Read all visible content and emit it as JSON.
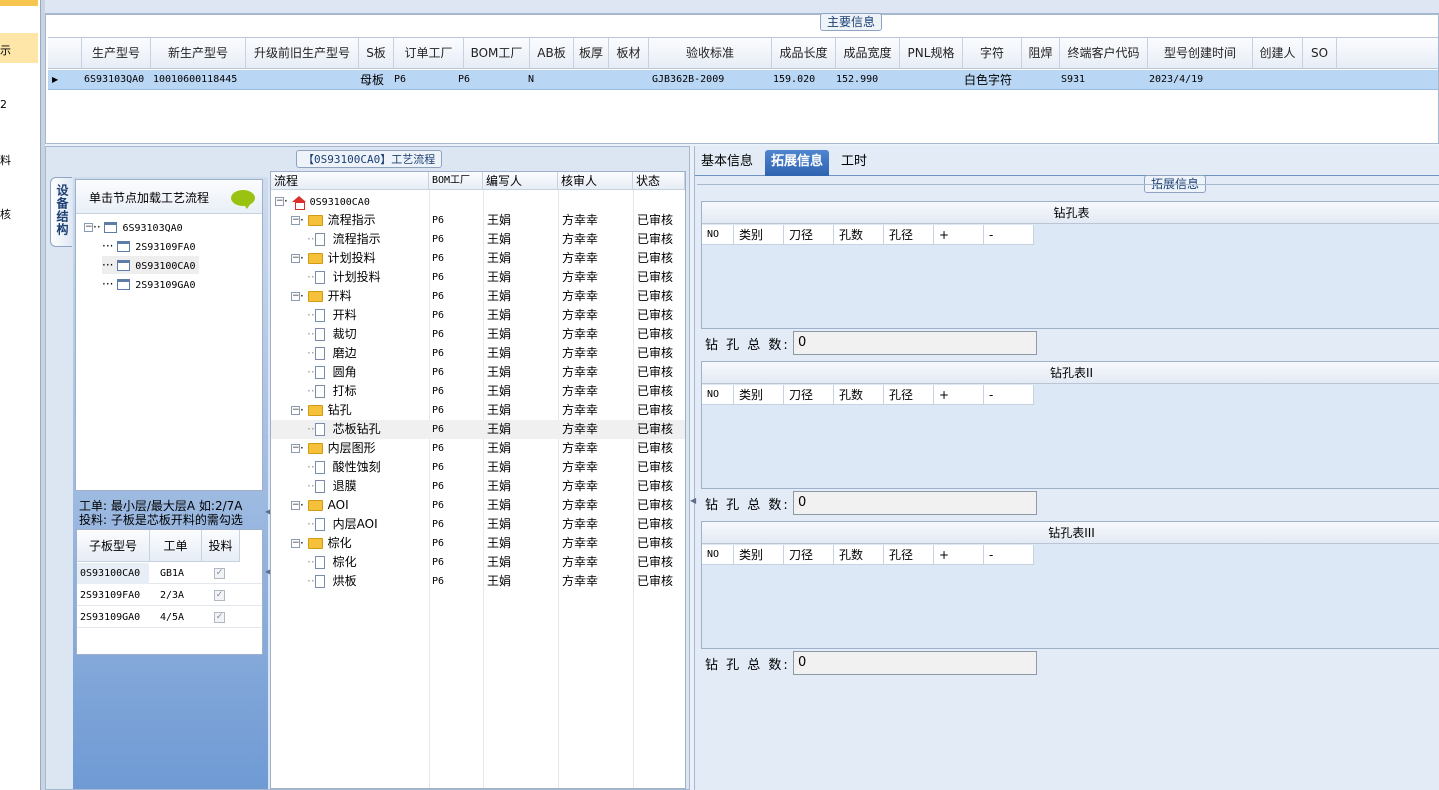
{
  "leftnav": {
    "items": [
      "示",
      "2",
      "料",
      "核"
    ]
  },
  "main": {
    "legend": "主要信息",
    "columns": [
      "生产型号",
      "新生产型号",
      "升级前旧生产型号",
      "S板",
      "订单工厂",
      "BOM工厂",
      "AB板",
      "板厚",
      "板材",
      "验收标准",
      "成品长度",
      "成品宽度",
      "PNL规格",
      "字符",
      "阻焊",
      "终端客户代码",
      "型号创建时间",
      "创建人",
      "SO"
    ],
    "row": {
      "c0": "6S93103QA0",
      "c1": "10010600118445",
      "c3": "母板",
      "c4": "P6",
      "c5": "P6",
      "c6": "N",
      "c9": "GJB362B-2009",
      "c10": "159.020",
      "c11": "152.990",
      "c13": "白色字符",
      "c15": "S931",
      "c16": "2023/4/19"
    }
  },
  "left": {
    "vtab": "设备结构",
    "tree_hint": "单击节点加载工艺流程",
    "tree": [
      "6S93103QA0",
      "2S93109FA0",
      "0S93100CA0",
      "2S93109GA0"
    ],
    "info_line1": "工单: 最小层/最大层A 如:2/7A",
    "info_line2": "投料: 子板是芯板开料的需勾选",
    "subgrid": {
      "headers": [
        "子板型号",
        "工单",
        "投料"
      ],
      "rows": [
        [
          "0S93100CA0",
          "GB1A"
        ],
        [
          "2S93109FA0",
          "2/3A"
        ],
        [
          "2S93109GA0",
          "4/5A"
        ]
      ]
    }
  },
  "flow": {
    "title": "【0S93100CA0】工艺流程",
    "headers": [
      "流程",
      "BOM工厂",
      "编写人",
      "核审人",
      "状态"
    ],
    "root": "0S93100CA0",
    "rows": [
      {
        "name": "流程指示",
        "f": "P6",
        "w": "王娟",
        "r": "方幸幸",
        "s": "已审核"
      },
      {
        "name": "流程指示",
        "f": "P6",
        "w": "王娟",
        "r": "方幸幸",
        "s": "已审核"
      },
      {
        "name": "计划投料",
        "f": "P6",
        "w": "王娟",
        "r": "方幸幸",
        "s": "已审核"
      },
      {
        "name": "计划投料",
        "f": "P6",
        "w": "王娟",
        "r": "方幸幸",
        "s": "已审核"
      },
      {
        "name": "开料",
        "f": "P6",
        "w": "王娟",
        "r": "方幸幸",
        "s": "已审核"
      },
      {
        "name": "开料",
        "f": "P6",
        "w": "王娟",
        "r": "方幸幸",
        "s": "已审核"
      },
      {
        "name": "裁切",
        "f": "P6",
        "w": "王娟",
        "r": "方幸幸",
        "s": "已审核"
      },
      {
        "name": "磨边",
        "f": "P6",
        "w": "王娟",
        "r": "方幸幸",
        "s": "已审核"
      },
      {
        "name": "圆角",
        "f": "P6",
        "w": "王娟",
        "r": "方幸幸",
        "s": "已审核"
      },
      {
        "name": "打标",
        "f": "P6",
        "w": "王娟",
        "r": "方幸幸",
        "s": "已审核"
      },
      {
        "name": "钻孔",
        "f": "P6",
        "w": "王娟",
        "r": "方幸幸",
        "s": "已审核"
      },
      {
        "name": "芯板钻孔",
        "f": "P6",
        "w": "王娟",
        "r": "方幸幸",
        "s": "已审核"
      },
      {
        "name": "内层图形",
        "f": "P6",
        "w": "王娟",
        "r": "方幸幸",
        "s": "已审核"
      },
      {
        "name": "酸性蚀刻",
        "f": "P6",
        "w": "王娟",
        "r": "方幸幸",
        "s": "已审核"
      },
      {
        "name": "退膜",
        "f": "P6",
        "w": "王娟",
        "r": "方幸幸",
        "s": "已审核"
      },
      {
        "name": "AOI",
        "f": "P6",
        "w": "王娟",
        "r": "方幸幸",
        "s": "已审核"
      },
      {
        "name": "内层AOI",
        "f": "P6",
        "w": "王娟",
        "r": "方幸幸",
        "s": "已审核"
      },
      {
        "name": "棕化",
        "f": "P6",
        "w": "王娟",
        "r": "方幸幸",
        "s": "已审核"
      },
      {
        "name": "棕化",
        "f": "P6",
        "w": "王娟",
        "r": "方幸幸",
        "s": "已审核"
      },
      {
        "name": "烘板",
        "f": "P6",
        "w": "王娟",
        "r": "方幸幸",
        "s": "已审核"
      }
    ]
  },
  "right": {
    "tabs": [
      "基本信息",
      "拓展信息",
      "工时"
    ],
    "legend": "拓展信息",
    "drill_headers": [
      "NO",
      "类别",
      "刀径",
      "孔数",
      "孔径",
      "+",
      "-"
    ],
    "tables": [
      {
        "title": "钻孔表",
        "total_label": "钻 孔 总 数:",
        "total": "0"
      },
      {
        "title": "钻孔表II",
        "total_label": "钻 孔 总 数:",
        "total": "0"
      },
      {
        "title": "钻孔表III",
        "total_label": "钻 孔 总 数:",
        "total": "0"
      }
    ]
  }
}
